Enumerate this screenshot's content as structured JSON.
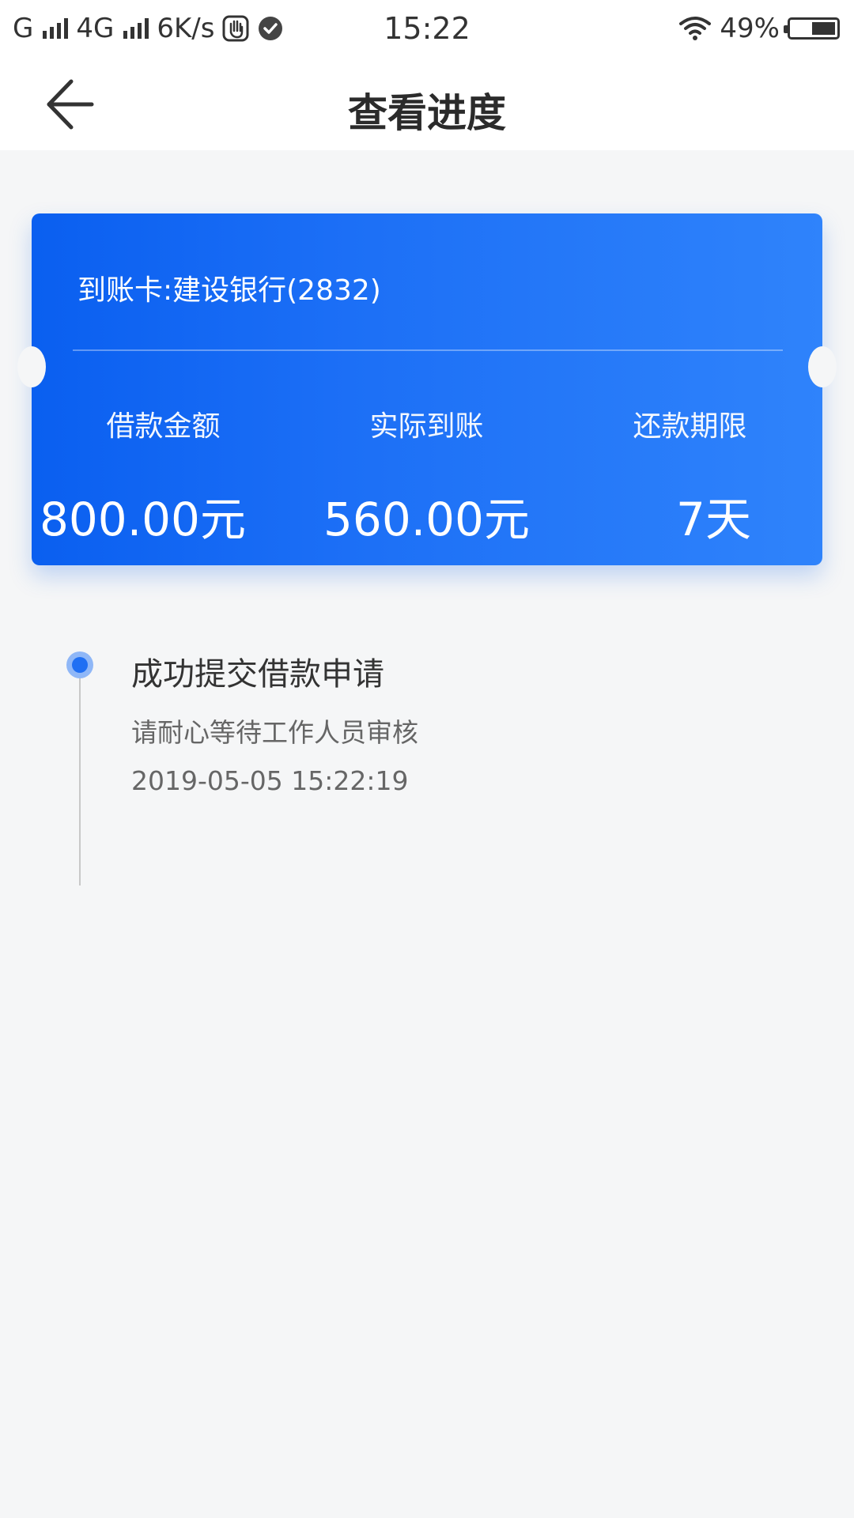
{
  "status_bar": {
    "carrier1": "G",
    "carrier2": "4G",
    "speed": "6K/s",
    "time": "15:22",
    "battery": "49%"
  },
  "header": {
    "title": "查看进度"
  },
  "card": {
    "account": "到账卡:建设银行(2832)",
    "columns": [
      {
        "label": "借款金额",
        "value": "800.00元"
      },
      {
        "label": "实际到账",
        "value": "560.00元"
      },
      {
        "label": "还款期限",
        "value": "7天"
      }
    ],
    "gradient_colors": [
      "#0a5ff0",
      "#2f83fb"
    ]
  },
  "timeline": {
    "items": [
      {
        "title": "成功提交借款申请",
        "subtitle": "请耐心等待工作人员审核",
        "time": "2019-05-05 15:22:19"
      }
    ],
    "accent": "#1f6ff3"
  }
}
